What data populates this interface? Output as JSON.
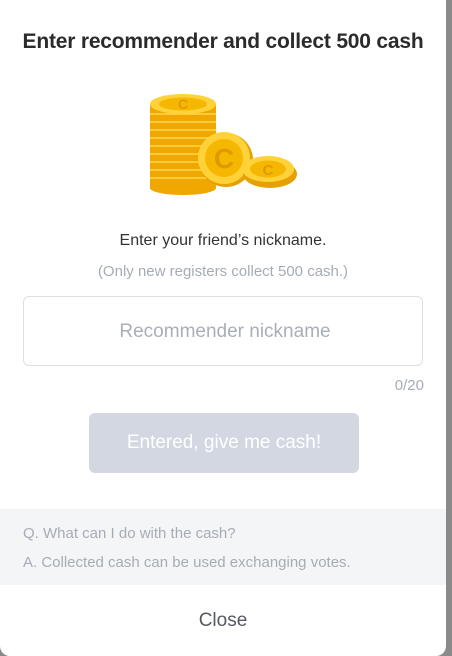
{
  "dialog": {
    "title": "Enter recommender and collect 500 cash",
    "prompt": "Enter your friend’s nickname.",
    "note": "(Only new registers collect 500 cash.)",
    "input": {
      "placeholder": "Recommender nickname",
      "value": ""
    },
    "counter": "0/20",
    "submit_label": "Entered, give me cash!",
    "faq": {
      "question": "Q. What can I do with the cash?",
      "answer": "A. Collected cash can be used exchanging votes."
    },
    "close_label": "Close"
  },
  "icons": {
    "illustration": "gold-coins-icon"
  },
  "colors": {
    "coin_gold": "#f5b301",
    "button_disabled": "#d2d7e2",
    "faq_background": "#f4f5f7"
  }
}
